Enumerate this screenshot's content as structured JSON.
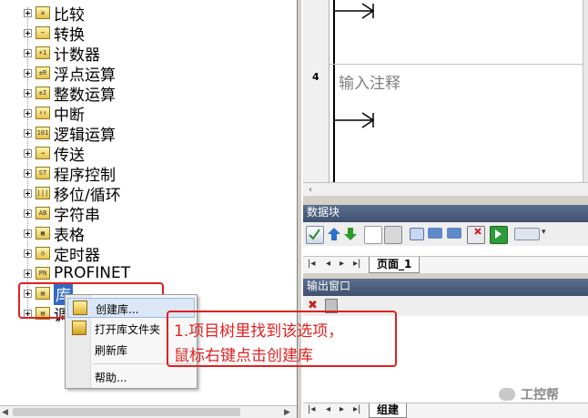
{
  "project_tree": {
    "items": [
      {
        "label": "比较",
        "icon": "compare-icon",
        "glyph": "≥"
      },
      {
        "label": "转换",
        "icon": "convert-icon",
        "glyph": "~"
      },
      {
        "label": "计数器",
        "icon": "counter-icon",
        "glyph": "+1"
      },
      {
        "label": "浮点运算",
        "icon": "float-math-icon",
        "glyph": "±R"
      },
      {
        "label": "整数运算",
        "icon": "integer-math-icon",
        "glyph": "±I"
      },
      {
        "label": "中断",
        "icon": "interrupt-icon",
        "glyph": "↑↑"
      },
      {
        "label": "逻辑运算",
        "icon": "logic-icon",
        "glyph": "101"
      },
      {
        "label": "传送",
        "icon": "transfer-icon",
        "glyph": "→"
      },
      {
        "label": "程序控制",
        "icon": "program-control-icon",
        "glyph": "ST"
      },
      {
        "label": "移位/循环",
        "icon": "shift-rotate-icon",
        "glyph": "|||"
      },
      {
        "label": "字符串",
        "icon": "string-icon",
        "glyph": "AB"
      },
      {
        "label": "表格",
        "icon": "table-icon",
        "glyph": "▦"
      },
      {
        "label": "定时器",
        "icon": "timer-icon",
        "glyph": "◷"
      },
      {
        "label": "PROFINET",
        "icon": "profinet-icon",
        "glyph": "PN"
      },
      {
        "label": "库",
        "icon": "library-folder-icon",
        "glyph": "▤"
      },
      {
        "label": "调",
        "icon": "call-subroutine-icon",
        "glyph": "▤"
      }
    ]
  },
  "ladder_editor": {
    "network_number": "4",
    "comment_placeholder": "输入注释"
  },
  "data_block_panel": {
    "title": "数据块",
    "page_tab": "页面_1"
  },
  "output_panel": {
    "title": "输出窗口",
    "bottom_tab": "组建"
  },
  "context_menu": {
    "items": [
      "创建库...",
      "打开库文件夹",
      "刷新库",
      "帮助..."
    ]
  },
  "annotation": {
    "line1": "1.项目树里找到该选项，",
    "line2": "鼠标右键点击创建库"
  },
  "watermark": "工控帮",
  "colors": {
    "annotation_red": "#e02020",
    "panel_header": "#4a5d7c",
    "selection_blue": "#316ac5"
  }
}
